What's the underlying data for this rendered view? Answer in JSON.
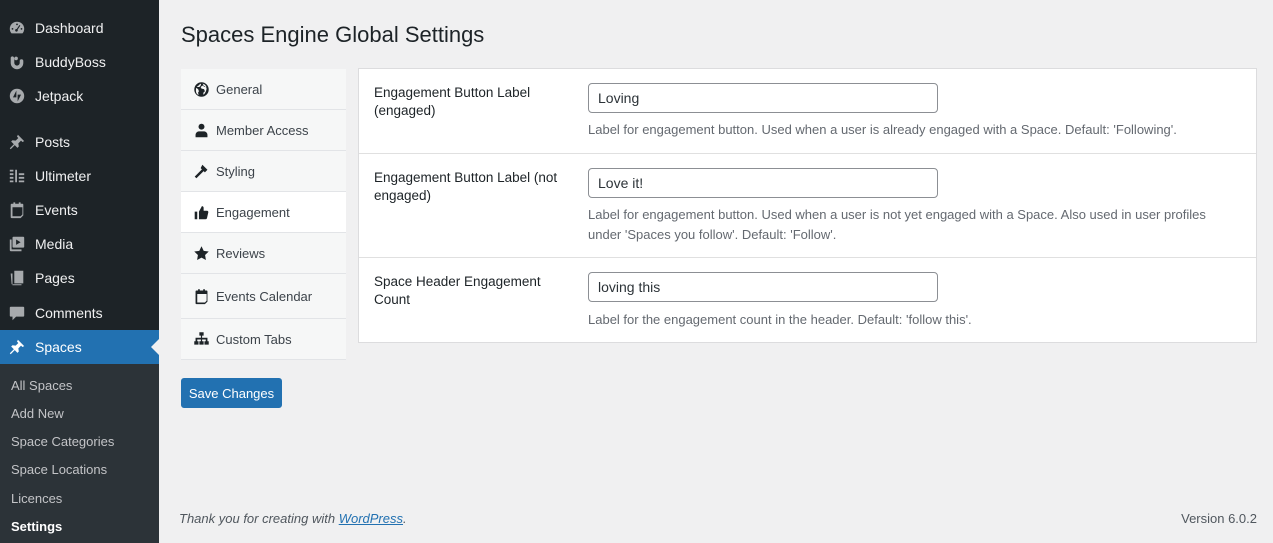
{
  "sidebar": {
    "menu": [
      {
        "label": "Dashboard",
        "icon": "dashboard-icon"
      },
      {
        "label": "BuddyBoss",
        "icon": "buddyboss-icon"
      },
      {
        "label": "Jetpack",
        "icon": "jetpack-icon"
      },
      {
        "label": "Posts",
        "icon": "pin-icon"
      },
      {
        "label": "Ultimeter",
        "icon": "ultimeter-icon"
      },
      {
        "label": "Events",
        "icon": "calendar-icon"
      },
      {
        "label": "Media",
        "icon": "media-icon"
      },
      {
        "label": "Pages",
        "icon": "pages-icon"
      },
      {
        "label": "Comments",
        "icon": "comments-icon"
      },
      {
        "label": "Spaces",
        "icon": "pin-icon"
      }
    ],
    "submenu": [
      "All Spaces",
      "Add New",
      "Space Categories",
      "Space Locations",
      "Licences",
      "Settings"
    ]
  },
  "page": {
    "title": "Spaces Engine Global Settings"
  },
  "tabs": [
    {
      "label": "General",
      "icon": "globe-icon"
    },
    {
      "label": "Member Access",
      "icon": "user-icon"
    },
    {
      "label": "Styling",
      "icon": "hammer-icon"
    },
    {
      "label": "Engagement",
      "icon": "thumbs-up-icon"
    },
    {
      "label": "Reviews",
      "icon": "star-icon"
    },
    {
      "label": "Events Calendar",
      "icon": "calendar-icon"
    },
    {
      "label": "Custom Tabs",
      "icon": "sitemap-icon"
    }
  ],
  "settings": [
    {
      "label": "Engagement Button Label (engaged)",
      "value": "Loving",
      "description": "Label for engagement button. Used when a user is already engaged with a Space. Default: 'Following'."
    },
    {
      "label": "Engagement Button Label (not engaged)",
      "value": "Love it!",
      "description": "Label for engagement button. Used when a user is not yet engaged with a Space. Also used in user profiles under 'Spaces you follow'. Default: 'Follow'."
    },
    {
      "label": "Space Header Engagement Count",
      "value": "loving this",
      "description": "Label for the engagement count in the header. Default: 'follow this'."
    }
  ],
  "actions": {
    "save_label": "Save Changes"
  },
  "footer": {
    "thanks_prefix": "Thank you for creating with",
    "thanks_link": "WordPress",
    "thanks_suffix": ".",
    "version": "Version 6.0.2"
  },
  "colors": {
    "sidebar_bg": "#1d2327",
    "accent": "#2271b1",
    "page_bg": "#f0f0f1"
  }
}
